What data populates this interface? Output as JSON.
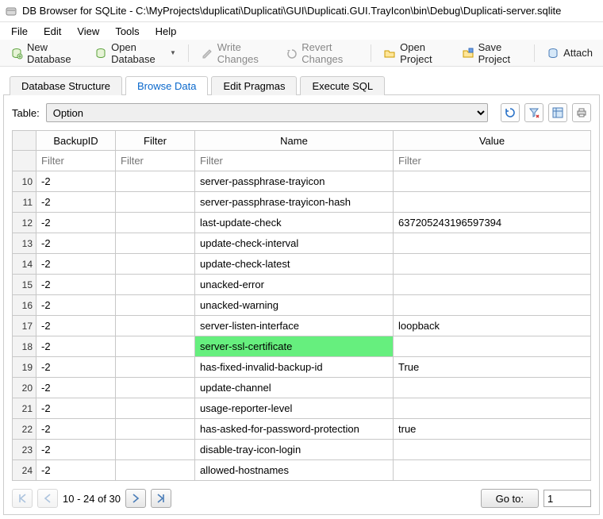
{
  "window": {
    "title": "DB Browser for SQLite - C:\\MyProjects\\duplicati\\Duplicati\\GUI\\Duplicati.GUI.TrayIcon\\bin\\Debug\\Duplicati-server.sqlite"
  },
  "menu": {
    "file": "File",
    "edit": "Edit",
    "view": "View",
    "tools": "Tools",
    "help": "Help"
  },
  "toolbar": {
    "new_database": "New Database",
    "open_database": "Open Database",
    "write_changes": "Write Changes",
    "revert_changes": "Revert Changes",
    "open_project": "Open Project",
    "save_project": "Save Project",
    "attach": "Attach"
  },
  "tabs": {
    "structure": "Database Structure",
    "browse": "Browse Data",
    "pragmas": "Edit Pragmas",
    "execute": "Execute SQL"
  },
  "browse": {
    "table_label": "Table:",
    "selected_table": "Option",
    "filter_placeholder": "Filter"
  },
  "columns": {
    "backup_id": "BackupID",
    "filter": "Filter",
    "name": "Name",
    "value": "Value"
  },
  "rows": [
    {
      "n": "10",
      "backup_id": "-2",
      "filter": "",
      "name": "server-passphrase-trayicon",
      "value": "",
      "hl": false
    },
    {
      "n": "11",
      "backup_id": "-2",
      "filter": "",
      "name": "server-passphrase-trayicon-hash",
      "value": "",
      "hl": false
    },
    {
      "n": "12",
      "backup_id": "-2",
      "filter": "",
      "name": "last-update-check",
      "value": "637205243196597394",
      "hl": false
    },
    {
      "n": "13",
      "backup_id": "-2",
      "filter": "",
      "name": "update-check-interval",
      "value": "",
      "hl": false
    },
    {
      "n": "14",
      "backup_id": "-2",
      "filter": "",
      "name": "update-check-latest",
      "value": "",
      "hl": false
    },
    {
      "n": "15",
      "backup_id": "-2",
      "filter": "",
      "name": "unacked-error",
      "value": "",
      "hl": false
    },
    {
      "n": "16",
      "backup_id": "-2",
      "filter": "",
      "name": "unacked-warning",
      "value": "",
      "hl": false
    },
    {
      "n": "17",
      "backup_id": "-2",
      "filter": "",
      "name": "server-listen-interface",
      "value": "loopback",
      "hl": false
    },
    {
      "n": "18",
      "backup_id": "-2",
      "filter": "",
      "name": "server-ssl-certificate",
      "value": "",
      "hl": true
    },
    {
      "n": "19",
      "backup_id": "-2",
      "filter": "",
      "name": "has-fixed-invalid-backup-id",
      "value": "True",
      "hl": false
    },
    {
      "n": "20",
      "backup_id": "-2",
      "filter": "",
      "name": "update-channel",
      "value": "",
      "hl": false
    },
    {
      "n": "21",
      "backup_id": "-2",
      "filter": "",
      "name": "usage-reporter-level",
      "value": "",
      "hl": false
    },
    {
      "n": "22",
      "backup_id": "-2",
      "filter": "",
      "name": "has-asked-for-password-protection",
      "value": "true",
      "hl": false
    },
    {
      "n": "23",
      "backup_id": "-2",
      "filter": "",
      "name": "disable-tray-icon-login",
      "value": "",
      "hl": false
    },
    {
      "n": "24",
      "backup_id": "-2",
      "filter": "",
      "name": "allowed-hostnames",
      "value": "",
      "hl": false
    }
  ],
  "pager": {
    "status": "10 - 24 of 30",
    "goto_label": "Go to:",
    "goto_value": "1"
  },
  "colors": {
    "highlight": "#66ef7e"
  }
}
